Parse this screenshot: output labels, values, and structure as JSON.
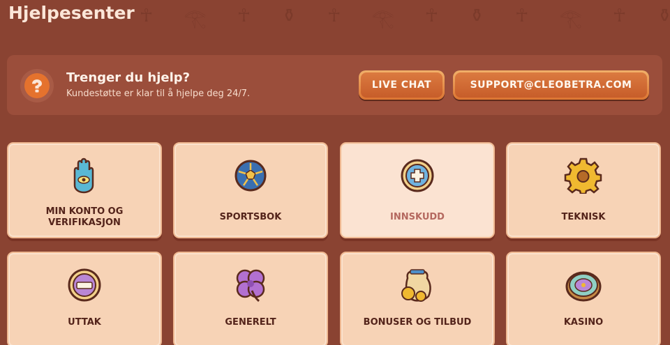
{
  "header": {
    "title": "Hjelpesenter",
    "decor_glyphs": [
      "☥",
      "𓂀",
      "☥",
      "⚱",
      "☥",
      "𓂀",
      "☥",
      "⚱",
      "☥",
      "𓂀",
      "☥",
      "⚱",
      "☥",
      "𓂀"
    ]
  },
  "help_banner": {
    "title": "Trenger du hjelp?",
    "subtitle": "Kundestøtte er klar til å hjelpe deg 24/7.",
    "live_chat_label": "LIVE CHAT",
    "email_label": "SUPPORT@CLEOBETRA.COM",
    "icon": "question-icon"
  },
  "categories": [
    {
      "label": "MIN KONTO OG VERIFIKASJON",
      "icon": "hamsa-hand-icon",
      "active": false
    },
    {
      "label": "SPORTSBOK",
      "icon": "football-icon",
      "active": false
    },
    {
      "label": "INNSKUDD",
      "icon": "plus-coin-icon",
      "active": true
    },
    {
      "label": "TEKNISK",
      "icon": "gear-icon",
      "active": false
    },
    {
      "label": "UTTAK",
      "icon": "minus-coin-icon",
      "active": false
    },
    {
      "label": "GENERELT",
      "icon": "clover-icon",
      "active": false
    },
    {
      "label": "BONUSER OG TILBUD",
      "icon": "coin-sack-icon",
      "active": false
    },
    {
      "label": "KASINO",
      "icon": "casino-chip-icon",
      "active": false
    }
  ],
  "colors": {
    "background": "#8a4332",
    "banner": "#9b4e3b",
    "accent_orange": "#e5722d",
    "card": "#f7d3b6",
    "card_active": "#fbe3d2",
    "card_text": "#53231a",
    "card_text_active": "#b4685f"
  }
}
